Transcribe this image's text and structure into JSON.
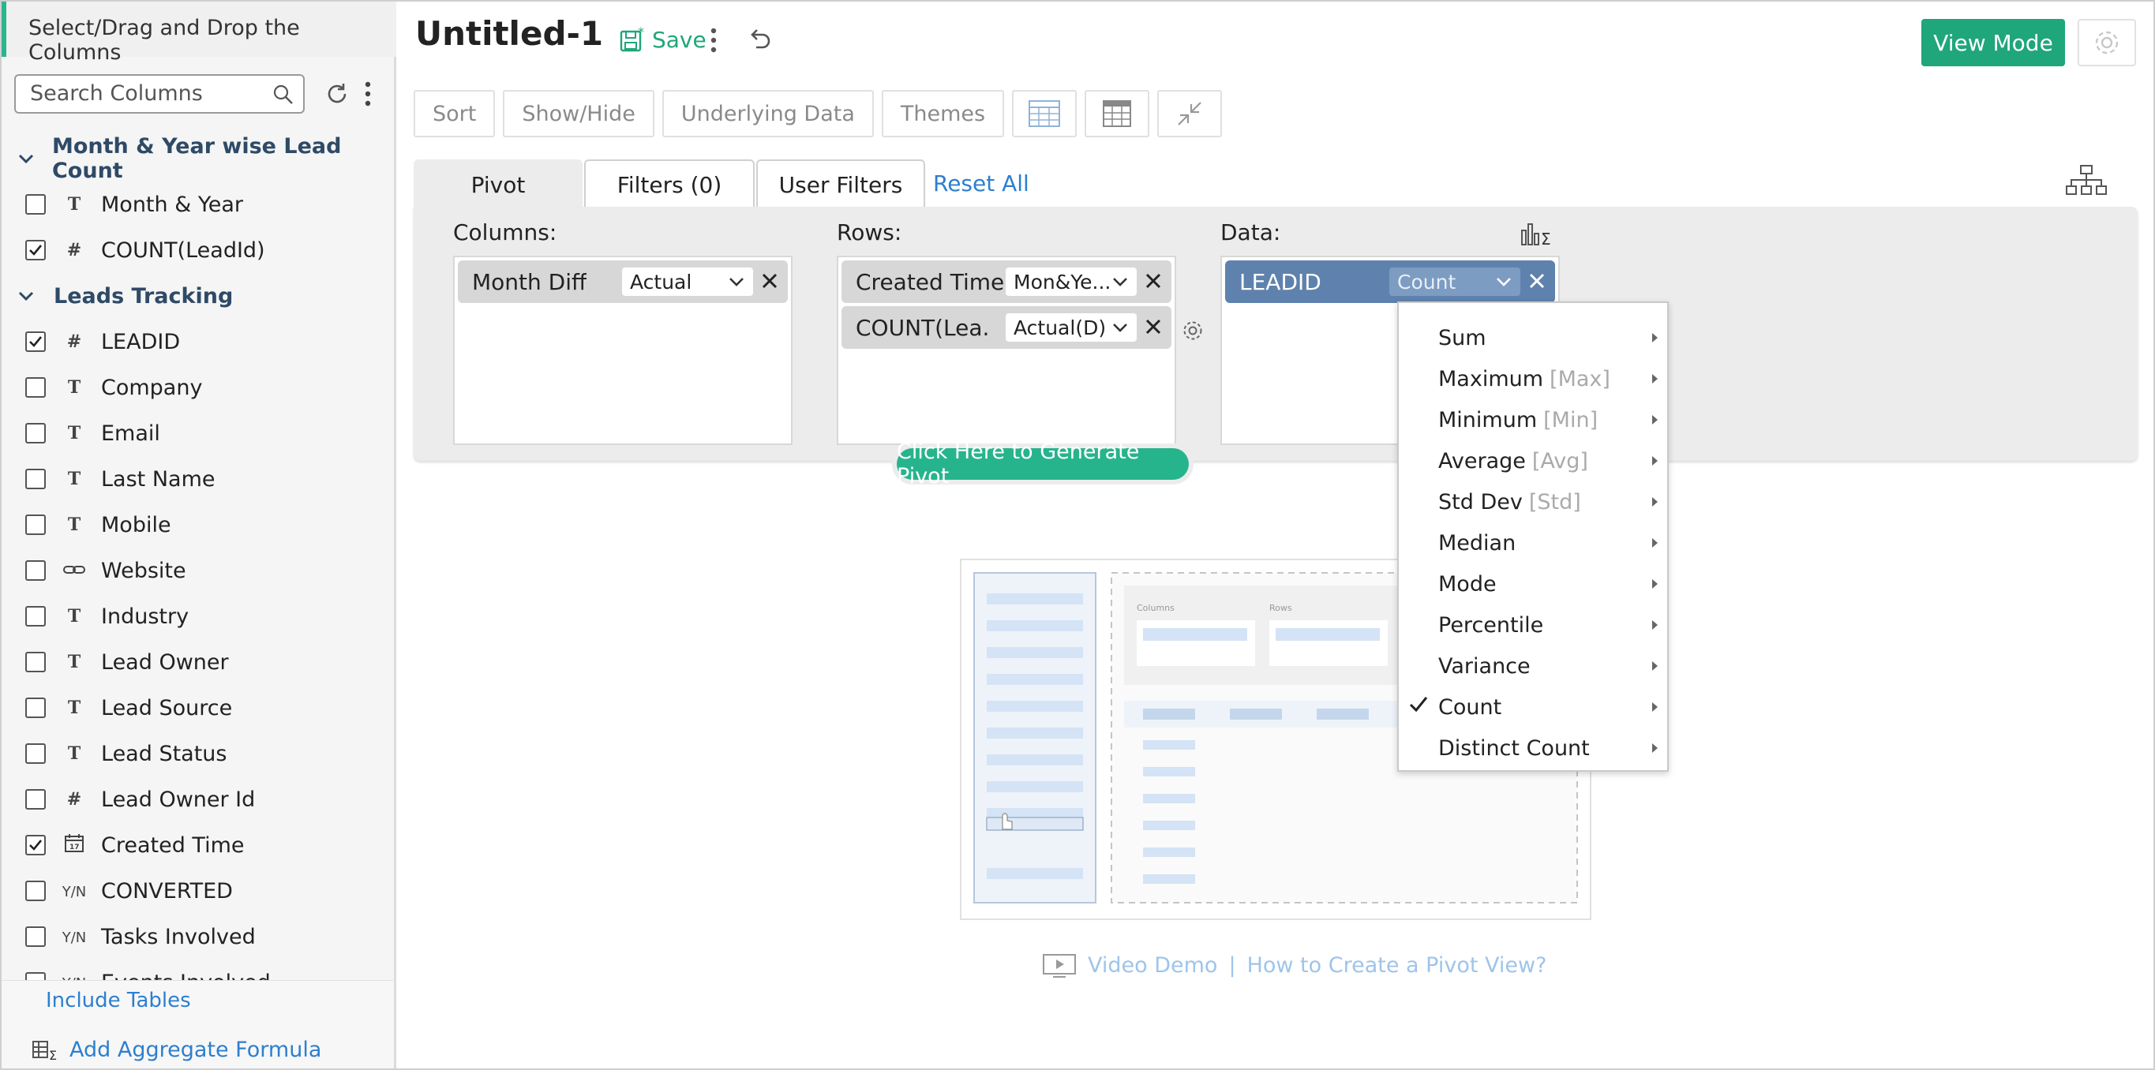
{
  "sidebar": {
    "title": "Select/Drag and Drop the Columns",
    "search_placeholder": "Search Columns",
    "groups": [
      {
        "name": "Month & Year wise Lead Count",
        "fields": [
          {
            "label": "Month & Year",
            "type": "T",
            "checked": false
          },
          {
            "label": "COUNT(LeadId)",
            "type": "#",
            "checked": true
          }
        ]
      },
      {
        "name": "Leads Tracking",
        "fields": [
          {
            "label": "LEADID",
            "type": "#",
            "checked": true
          },
          {
            "label": "Company",
            "type": "T",
            "checked": false
          },
          {
            "label": "Email",
            "type": "T",
            "checked": false
          },
          {
            "label": "Last Name",
            "type": "T",
            "checked": false
          },
          {
            "label": "Mobile",
            "type": "T",
            "checked": false
          },
          {
            "label": "Website",
            "type": "link",
            "checked": false
          },
          {
            "label": "Industry",
            "type": "T",
            "checked": false
          },
          {
            "label": "Lead Owner",
            "type": "T",
            "checked": false
          },
          {
            "label": "Lead Source",
            "type": "T",
            "checked": false
          },
          {
            "label": "Lead Status",
            "type": "T",
            "checked": false
          },
          {
            "label": "Lead Owner Id",
            "type": "#",
            "checked": false
          },
          {
            "label": "Created Time",
            "type": "date",
            "checked": true
          },
          {
            "label": "CONVERTED",
            "type": "Y/N",
            "checked": false
          },
          {
            "label": "Tasks Involved",
            "type": "Y/N",
            "checked": false
          },
          {
            "label": "Events Involved",
            "type": "Y/N",
            "checked": false
          }
        ]
      }
    ],
    "include_tables": "Include Tables",
    "add_aggregate": "Add Aggregate Formula"
  },
  "header": {
    "title": "Untitled-1",
    "save_label": "Save",
    "view_mode_label": "View Mode"
  },
  "toolbar": {
    "sort": "Sort",
    "show_hide": "Show/Hide",
    "underlying_data": "Underlying Data",
    "themes": "Themes"
  },
  "tabs": {
    "pivot": "Pivot",
    "filters": "Filters  (0)",
    "user_filters": "User Filters",
    "reset_all": "Reset All"
  },
  "zones": {
    "columns_label": "Columns:",
    "rows_label": "Rows:",
    "data_label": "Data:",
    "columns": [
      {
        "name": "Month Diff",
        "func": "Actual"
      }
    ],
    "rows": [
      {
        "name": "Created Time",
        "func": "Mon&Ye..."
      },
      {
        "name": "COUNT(Lea...",
        "func": "Actual(D)"
      }
    ],
    "data": [
      {
        "name": "LEADID",
        "func": "Count"
      }
    ]
  },
  "generate_label": "Click Here to Generate Pivot",
  "illustration": {
    "columns_label": "Columns",
    "rows_label": "Rows"
  },
  "video_demo": {
    "label": "Video Demo",
    "separator": "|",
    "link": "How to Create a Pivot View?"
  },
  "aggregate_menu": {
    "items": [
      {
        "label": "Sum",
        "hint": "",
        "checked": false
      },
      {
        "label": "Maximum",
        "hint": "[Max]",
        "checked": false
      },
      {
        "label": "Minimum",
        "hint": "[Min]",
        "checked": false
      },
      {
        "label": "Average",
        "hint": "[Avg]",
        "checked": false
      },
      {
        "label": "Std Dev",
        "hint": "[Std]",
        "checked": false
      },
      {
        "label": "Median",
        "hint": "",
        "checked": false
      },
      {
        "label": "Mode",
        "hint": "",
        "checked": false
      },
      {
        "label": "Percentile",
        "hint": "",
        "checked": false
      },
      {
        "label": "Variance",
        "hint": "",
        "checked": false
      },
      {
        "label": "Count",
        "hint": "",
        "checked": true
      },
      {
        "label": "Distinct Count",
        "hint": "",
        "checked": false
      }
    ]
  },
  "colors": {
    "accent": "#1fa67a",
    "link": "#2c7fcf",
    "data_pill": "#5e82ad"
  }
}
